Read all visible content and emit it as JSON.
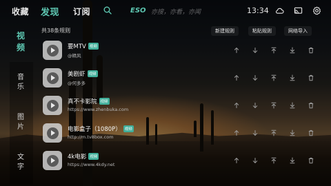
{
  "nav": {
    "favorites": "收藏",
    "discover": "发现",
    "subscribe": "订阅"
  },
  "search": {
    "brand": "ESO",
    "placeholder": "亦搜，亦看，亦闻"
  },
  "status": {
    "time": "13:34"
  },
  "icons": {
    "search": "search-icon",
    "cloud": "cloud-icon",
    "cast": "cast-icon",
    "settings": "gear-icon"
  },
  "categories": [
    {
      "label": "视频",
      "chars": [
        "视",
        "频"
      ],
      "active": true
    },
    {
      "label": "音乐",
      "chars": [
        "音",
        "乐"
      ],
      "active": false
    },
    {
      "label": "图片",
      "chars": [
        "图",
        "片"
      ],
      "active": false
    },
    {
      "label": "文字",
      "chars": [
        "文",
        "字"
      ],
      "active": false
    }
  ],
  "main": {
    "count_text": "共38条规则",
    "actions": {
      "new_rule": "新建规则",
      "paste_rule": "粘贴规则",
      "import_rule": "网络导入"
    }
  },
  "rules": [
    {
      "name": "要MTV",
      "badge": "视频",
      "url": "@精风"
    },
    {
      "name": "美剧虾",
      "badge": "视频",
      "url": "@何多多"
    },
    {
      "name": "真不卡影院",
      "badge": "视频",
      "url": "https://www.zhenbuka.com"
    },
    {
      "name": "电影盒子（1080P）",
      "badge": "视频",
      "url": "http://m.tv8box.com"
    },
    {
      "name": "4k电影",
      "badge": "视频",
      "url": "https://www.4kdy.net"
    }
  ],
  "row_controls": [
    "arrow-up-icon",
    "arrow-down-icon",
    "move-to-top-icon",
    "move-to-bottom-icon",
    "trash-icon"
  ],
  "colors": {
    "accent": "#5ec7b2",
    "badge": "#3fae99",
    "text": "#ffffff"
  }
}
